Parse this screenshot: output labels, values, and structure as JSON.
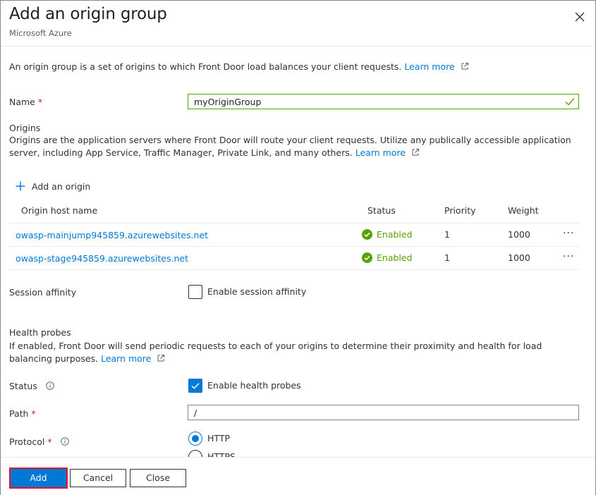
{
  "header": {
    "title": "Add an origin group",
    "subtitle": "Microsoft Azure"
  },
  "intro": {
    "text": "An origin group is a set of origins to which Front Door load balances your client requests.",
    "learn_more": "Learn more"
  },
  "name_field": {
    "label": "Name",
    "required_mark": "*",
    "value": "myOriginGroup"
  },
  "origins": {
    "heading": "Origins",
    "description": "Origins are the application servers where Front Door will route your client requests. Utilize any publically accessible application server, including App Service, Traffic Manager, Private Link, and many others.",
    "learn_more": "Learn more",
    "add_label": "Add an origin",
    "columns": [
      "Origin host name",
      "Status",
      "Priority",
      "Weight"
    ],
    "rows": [
      {
        "host": "owasp-mainjump945859.azurewebsites.net",
        "status": "Enabled",
        "priority": "1",
        "weight": "1000",
        "menu": "···"
      },
      {
        "host": "owasp-stage945859.azurewebsites.net",
        "status": "Enabled",
        "priority": "1",
        "weight": "1000",
        "menu": "···"
      }
    ]
  },
  "session_affinity": {
    "label": "Session affinity",
    "checkbox_label": "Enable session affinity",
    "checked": false
  },
  "health_probes": {
    "heading": "Health probes",
    "description": "If enabled, Front Door will send periodic requests to each of your origins to determine their proximity and health for load balancing purposes.",
    "learn_more": "Learn more",
    "status_label": "Status",
    "status_checkbox_label": "Enable health probes",
    "status_checked": true,
    "path_label": "Path",
    "path_required": "*",
    "path_value": "/",
    "protocol_label": "Protocol",
    "protocol_required": "*",
    "protocol_options": [
      "HTTP",
      "HTTPS"
    ],
    "protocol_selected": "HTTP"
  },
  "footer": {
    "add_label": "Add",
    "cancel_label": "Cancel",
    "close_label": "Close"
  },
  "colors": {
    "accent": "#0078d4",
    "success": "#57a300",
    "required": "#a4262c",
    "highlight": "#e81123"
  }
}
